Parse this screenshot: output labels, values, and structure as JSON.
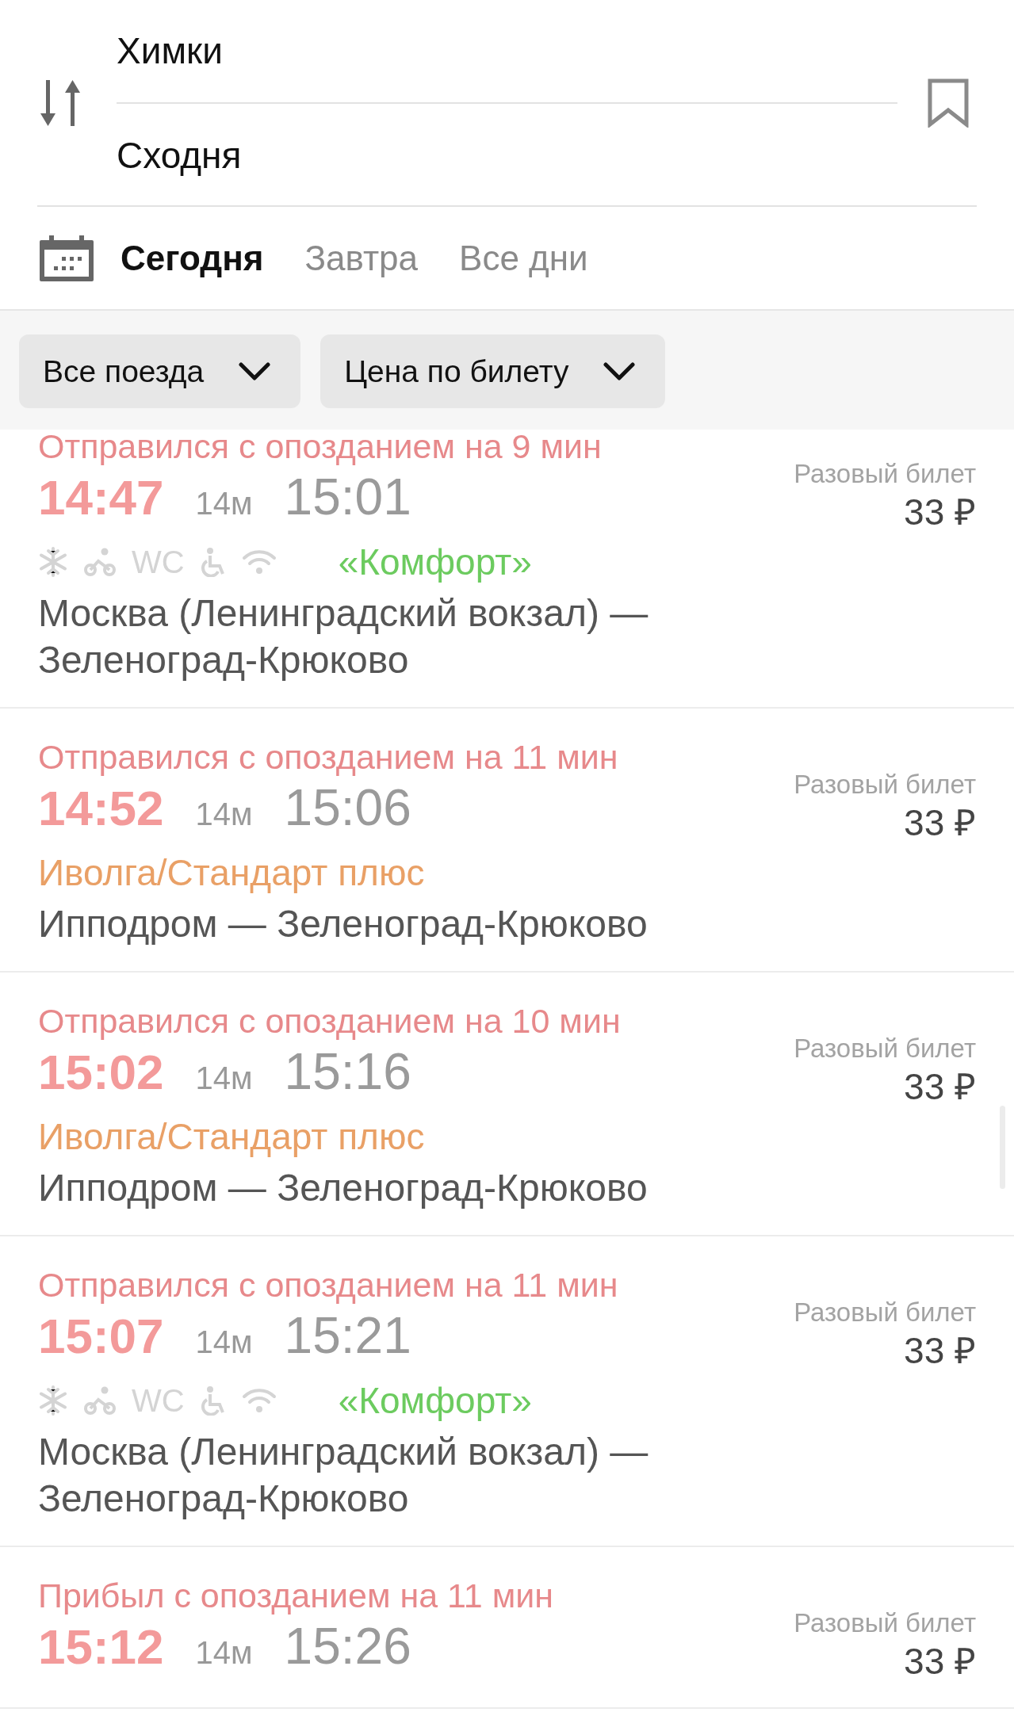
{
  "route": {
    "from": "Химки",
    "to": "Сходня"
  },
  "date_tabs": [
    {
      "label": "Сегодня",
      "selected": true
    },
    {
      "label": "Завтра",
      "selected": false
    },
    {
      "label": "Все дни",
      "selected": false
    }
  ],
  "filters": [
    {
      "label": "Все поезда"
    },
    {
      "label": "Цена по билету"
    }
  ],
  "trains": [
    {
      "status": "Отправился с опозданием на 9 мин",
      "departure": "14:47",
      "duration": "14м",
      "arrival": "15:01",
      "amenities": [
        {
          "kind": "snowflake"
        },
        {
          "kind": "bike"
        },
        {
          "kind": "text",
          "label": "WC"
        },
        {
          "kind": "wheelchair"
        },
        {
          "kind": "wifi"
        }
      ],
      "train_type": {
        "label": "«Комфорт»",
        "color": "#6ccb5f"
      },
      "route": "Москва (Ленинградский вокзал) — Зеленоград-Крюково",
      "ticket": "Разовый билет",
      "price": "33 ₽"
    },
    {
      "status": "Отправился с опозданием на 11 мин",
      "departure": "14:52",
      "duration": "14м",
      "arrival": "15:06",
      "train_type": {
        "label": "Иволга/Стандарт плюс",
        "color": "#e9a066"
      },
      "route": "Ипподром — Зеленоград-Крюково",
      "ticket": "Разовый билет",
      "price": "33 ₽"
    },
    {
      "status": "Отправился с опозданием на 10 мин",
      "departure": "15:02",
      "duration": "14м",
      "arrival": "15:16",
      "train_type": {
        "label": "Иволга/Стандарт плюс",
        "color": "#e9a066"
      },
      "route": "Ипподром — Зеленоград-Крюково",
      "ticket": "Разовый билет",
      "price": "33 ₽"
    },
    {
      "status": "Отправился с опозданием на 11 мин",
      "departure": "15:07",
      "duration": "14м",
      "arrival": "15:21",
      "amenities": [
        {
          "kind": "snowflake"
        },
        {
          "kind": "bike"
        },
        {
          "kind": "text",
          "label": "WC"
        },
        {
          "kind": "wheelchair"
        },
        {
          "kind": "wifi"
        }
      ],
      "train_type": {
        "label": "«Комфорт»",
        "color": "#6ccb5f"
      },
      "route": "Москва (Ленинградский вокзал) — Зеленоград-Крюково",
      "ticket": "Разовый билет",
      "price": "33 ₽"
    },
    {
      "status": "Прибыл с опозданием на 11 мин",
      "departure": "15:12",
      "duration": "14м",
      "arrival": "15:26",
      "ticket": "Разовый билет",
      "price": "33 ₽"
    }
  ]
}
